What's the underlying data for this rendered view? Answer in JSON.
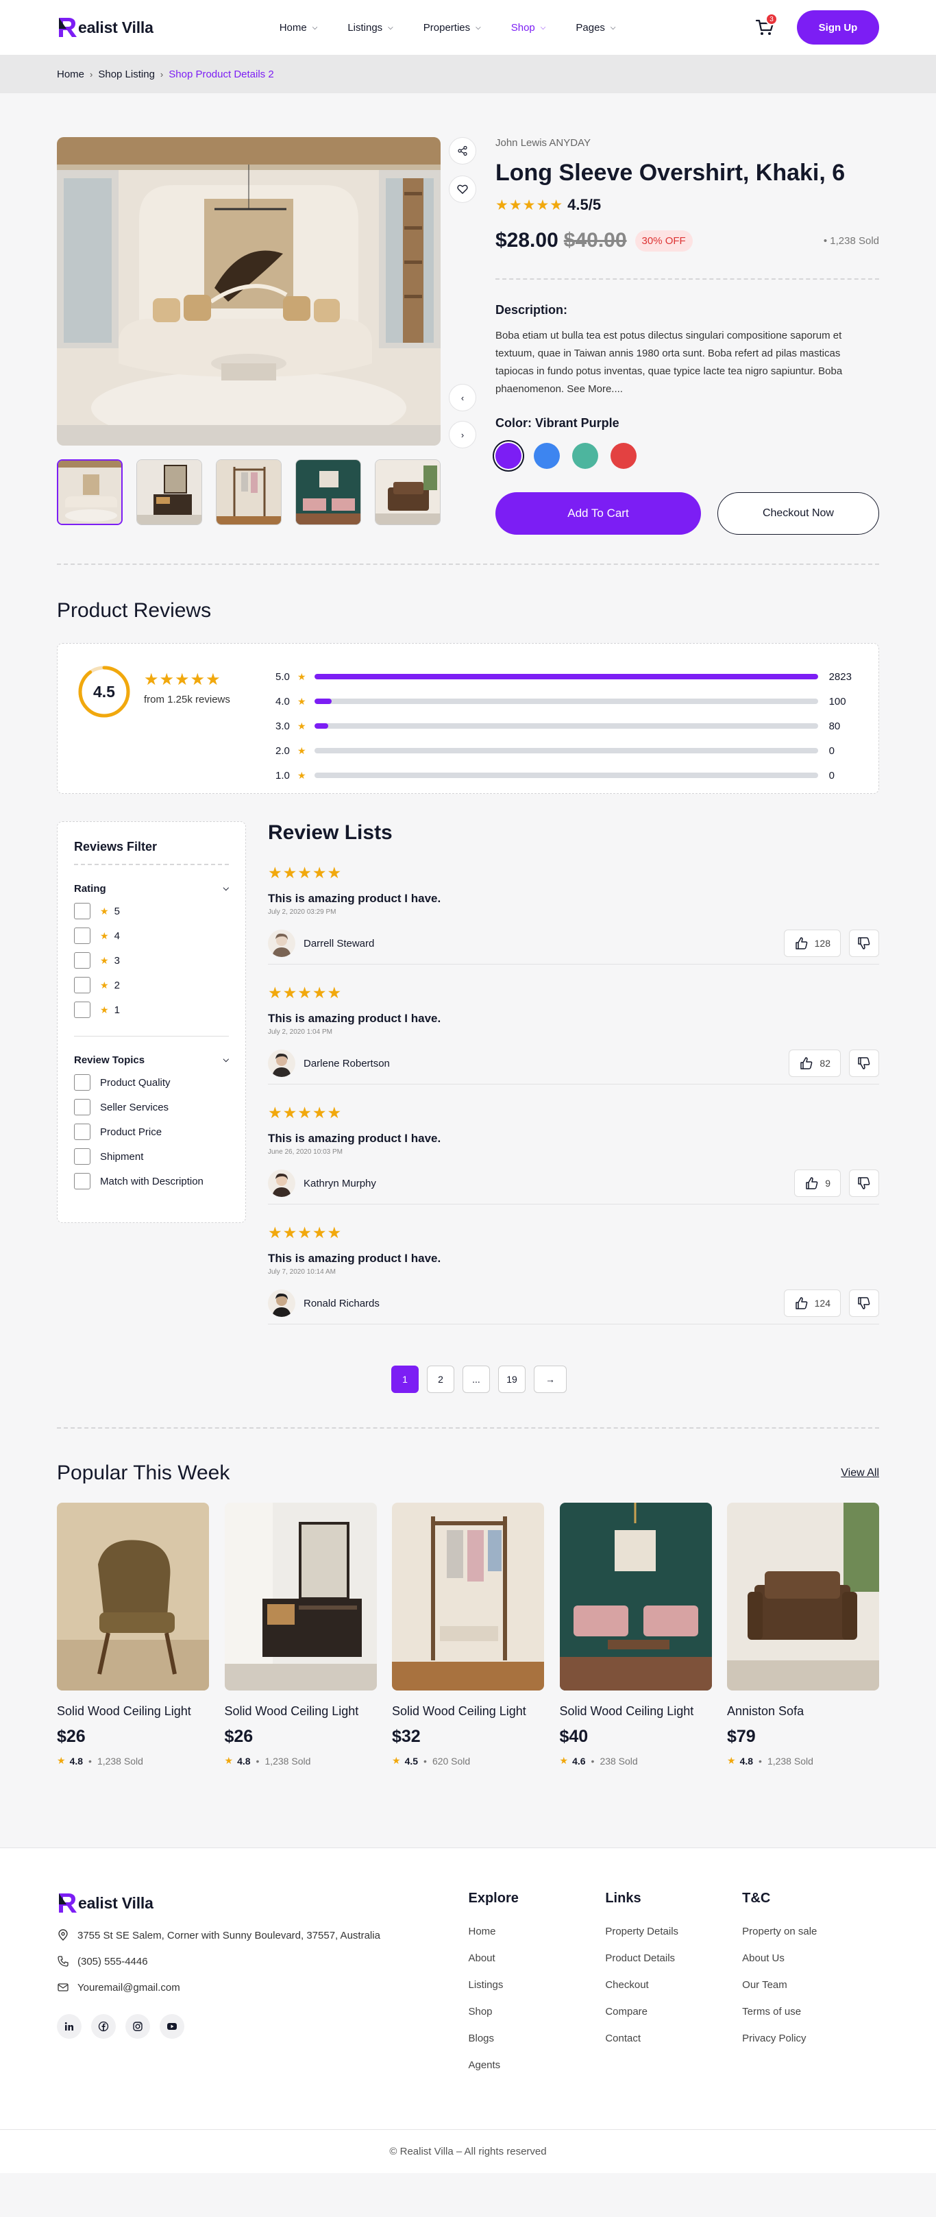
{
  "header": {
    "logo_text": "ealist Villa",
    "nav": [
      {
        "label": "Home",
        "active": false
      },
      {
        "label": "Listings",
        "active": false
      },
      {
        "label": "Properties",
        "active": false
      },
      {
        "label": "Shop",
        "active": true
      },
      {
        "label": "Pages",
        "active": false
      }
    ],
    "cart_count": "3",
    "signup_label": "Sign Up"
  },
  "breadcrumb": {
    "items": [
      "Home",
      "Shop Listing"
    ],
    "current": "Shop Product Details 2"
  },
  "product": {
    "brand": "John Lewis ANYDAY",
    "title": "Long Sleeve Overshirt, Khaki, 6",
    "stars": "★★★★★",
    "rating": "4.5/5",
    "price": "$28.00",
    "old_price": "$40.00",
    "discount": "30% OFF",
    "sold": "• 1,238 Sold",
    "description_title": "Description:",
    "description": "Boba etiam ut bulla tea est potus dilectus singulari compositione saporum et textuum, quae in Taiwan annis 1980 orta sunt. Boba refert ad pilas masticas tapiocas in fundo potus inventas, quae typice lacte tea nigro sapiuntur. Boba phaenomenon. See More....",
    "color_title": "Color: Vibrant Purple",
    "swatches": [
      "#7c1ef4",
      "#3d85f0",
      "#4db59e",
      "#e34141"
    ],
    "add_to_cart": "Add To Cart",
    "checkout": "Checkout Now",
    "icons": [
      "share-icon",
      "heart-icon",
      "chevron-left-icon",
      "chevron-right-icon"
    ]
  },
  "reviews": {
    "section_title": "Product Reviews",
    "average": "4.5",
    "average_fraction": 0.9,
    "stars": "★★★★★",
    "from_text": "from 1.25k reviews",
    "breakdown": [
      {
        "label": "5.0",
        "count": "2823",
        "fraction": 1.0
      },
      {
        "label": "4.0",
        "count": "100",
        "fraction": 0.035
      },
      {
        "label": "3.0",
        "count": "80",
        "fraction": 0.028
      },
      {
        "label": "2.0",
        "count": "0",
        "fraction": 0
      },
      {
        "label": "1.0",
        "count": "0",
        "fraction": 0
      }
    ]
  },
  "filter": {
    "title": "Reviews Filter",
    "rating_label": "Rating",
    "ratings": [
      "5",
      "4",
      "3",
      "2",
      "1"
    ],
    "topics_label": "Review Topics",
    "topics": [
      "Product Quality",
      "Seller Services",
      "Product Price",
      "Shipment",
      "Match with Description"
    ]
  },
  "review_list": {
    "title": "Review Lists",
    "items": [
      {
        "stars": "★★★★★",
        "headline": "This is amazing product I have.",
        "date": "July 2, 2020 03:29 PM",
        "name": "Darrell Steward",
        "likes": "128"
      },
      {
        "stars": "★★★★★",
        "headline": "This is amazing product I have.",
        "date": "July 2, 2020 1:04 PM",
        "name": "Darlene Robertson",
        "likes": "82"
      },
      {
        "stars": "★★★★★",
        "headline": "This is amazing product I have.",
        "date": "June 26, 2020 10:03 PM",
        "name": "Kathryn Murphy",
        "likes": "9"
      },
      {
        "stars": "★★★★★",
        "headline": "This is amazing product I have.",
        "date": "July 7, 2020 10:14 AM",
        "name": "Ronald Richards",
        "likes": "124"
      }
    ]
  },
  "pagination": {
    "pages": [
      "1",
      "2",
      "...",
      "19"
    ],
    "next": "→",
    "active": "1"
  },
  "popular": {
    "title": "Popular This Week",
    "view_all": "View All",
    "items": [
      {
        "name": "Solid Wood Ceiling Light",
        "price": "$26",
        "rating": "4.8",
        "sold": "1,238 Sold"
      },
      {
        "name": "Solid Wood Ceiling Light",
        "price": "$26",
        "rating": "4.8",
        "sold": "1,238 Sold"
      },
      {
        "name": "Solid Wood Ceiling Light",
        "price": "$32",
        "rating": "4.5",
        "sold": "620 Sold"
      },
      {
        "name": "Solid Wood Ceiling Light",
        "price": "$40",
        "rating": "4.6",
        "sold": "238 Sold"
      },
      {
        "name": "Anniston Sofa",
        "price": "$79",
        "rating": "4.8",
        "sold": "1,238 Sold"
      }
    ]
  },
  "footer": {
    "logo_text": "ealist Villa",
    "address": "3755 St SE Salem, Corner with Sunny Boulevard, 37557, Australia",
    "phone": "(305) 555-4446",
    "email": "Youremail@gmail.com",
    "socials": [
      "linkedin-icon",
      "facebook-icon",
      "instagram-icon",
      "youtube-icon"
    ],
    "columns": [
      {
        "title": "Explore",
        "links": [
          "Home",
          "About",
          "Listings",
          "Shop",
          "Blogs",
          "Agents"
        ]
      },
      {
        "title": "Links",
        "links": [
          "Property Details",
          "Product Details",
          "Checkout",
          "Compare",
          "Contact"
        ]
      },
      {
        "title": "T&C",
        "links": [
          "Property on sale",
          "About Us",
          "Our Team",
          "Terms of use",
          "Privacy Policy"
        ]
      }
    ],
    "copyright": "© Realist Villa – All rights reserved"
  }
}
